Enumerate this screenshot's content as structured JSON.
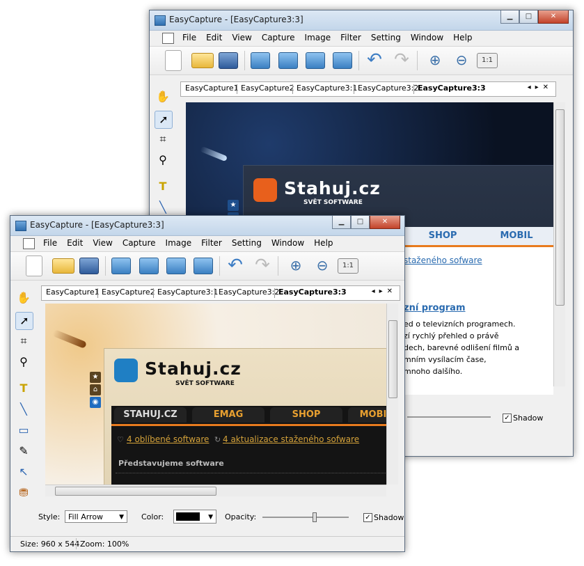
{
  "window": {
    "title": "EasyCapture - [EasyCapture3:3]",
    "caption_buttons": {
      "minimize": "▁",
      "maximize": "□",
      "close": "✕"
    }
  },
  "menu": [
    "File",
    "Edit",
    "View",
    "Capture",
    "Image",
    "Filter",
    "Setting",
    "Window",
    "Help"
  ],
  "tabs": [
    "EasyCapture1",
    "EasyCapture2",
    "EasyCapture3:1",
    "EasyCapture3:2",
    "EasyCapture3:3"
  ],
  "tab_nav": "◂▸✕",
  "toolbar_icons": [
    "new-file-icon",
    "open-folder-icon",
    "save-icon",
    "capture-screen-icon",
    "capture-window-icon",
    "capture-region-icon",
    "capture-scroll-icon",
    "undo-icon",
    "redo-icon",
    "zoom-in-icon",
    "zoom-out-icon",
    "actual-size-icon"
  ],
  "toolbar_11": "1:1",
  "website": {
    "logo": "Stahuj.cz",
    "tagline": "SVĚT SOFTWARE",
    "nav_front": [
      "STAHUJ.CZ",
      "EMAG",
      "SHOP",
      "MOBIL"
    ],
    "nav_back": [
      "SHOP",
      "MOBIL"
    ],
    "nav_front_visible_last": "MOBI",
    "link1": "4 oblíbené software",
    "link2": "4 aktualizace staženého sofware",
    "link2_back": "staženého sofware",
    "section": "Představujeme software",
    "article_title": "zní program",
    "article_lines": [
      "ed o televizních programech.",
      "zí rychlý přehled o právě",
      "dech, barevné odlišení filmů a",
      "mním vysílacím čase,",
      "mnoho dalšího."
    ]
  },
  "options": {
    "style_label": "Style:",
    "style_value": "Fill Arrow",
    "color_label": "Color:",
    "opacity_label": "Opacity:",
    "shadow_label": "Shadow",
    "shadow_checked": "✓"
  },
  "status": {
    "size": "Size: 960 x 544",
    "zoom": "Zoom: 100%"
  },
  "colors": {
    "title_bar": "#c9dbee",
    "close": "#c8452b",
    "accent_orange": "#e87b1e",
    "brand_blue": "#1f7fc4"
  }
}
